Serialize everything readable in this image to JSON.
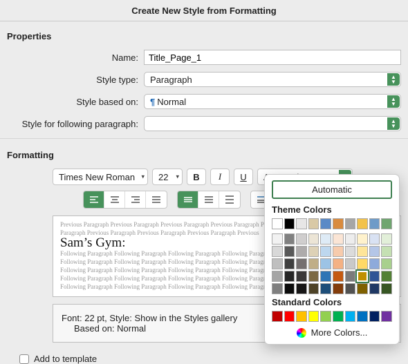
{
  "title": "Create New Style from Formatting",
  "sections": {
    "properties": "Properties",
    "formatting": "Formatting"
  },
  "props": {
    "name_label": "Name:",
    "name_value": "Title_Page_1",
    "type_label": "Style type:",
    "type_value": "Paragraph",
    "based_label": "Style based on:",
    "based_value": "Normal",
    "following_label": "Style for following paragraph:",
    "following_value": ""
  },
  "toolbar": {
    "font": "Times New Roman",
    "size": "22",
    "bold": "B",
    "italic": "I",
    "underline": "U",
    "color_label": "Automatic"
  },
  "preview": {
    "prev_line1": "Previous Paragraph Previous Paragraph Previous Paragraph Previous Paragraph Previous Paragraph Previous",
    "prev_line2": "Paragraph Previous Paragraph Previous Paragraph Previous Paragraph Previous",
    "sample": "Sam’s Gym:",
    "follow_line": "Following Paragraph Following Paragraph Following Paragraph Following Paragraph Following Paragraph"
  },
  "summary": {
    "line1": "Font: 22 pt, Style: Show in the Styles gallery",
    "line2": "Based on: Normal"
  },
  "footer": {
    "add_to_template": "Add to template"
  },
  "popover": {
    "automatic": "Automatic",
    "theme_head": "Theme Colors",
    "standard_head": "Standard Colors",
    "more": "More Colors...",
    "theme_row1": [
      "#ffffff",
      "#000000",
      "#e7e6e6",
      "#d9c9a6",
      "#5a8ac6",
      "#d98b3e",
      "#a6a6a6",
      "#f2c24b",
      "#6e9bc8",
      "#6fa56f"
    ],
    "theme_shades": [
      [
        "#f2f2f2",
        "#808080",
        "#d0cece",
        "#ece5d6",
        "#deebf6",
        "#fbe5d5",
        "#ededed",
        "#fff2cc",
        "#d9e2f3",
        "#e2efd9"
      ],
      [
        "#d8d8d8",
        "#595959",
        "#aeabab",
        "#ddd1b6",
        "#bdd7ee",
        "#f7cbac",
        "#dbdbdb",
        "#fee599",
        "#b4c6e7",
        "#c5e0b3"
      ],
      [
        "#bfbfbf",
        "#3f3f3f",
        "#757070",
        "#c0ae87",
        "#9cc3e5",
        "#f4b183",
        "#c9c9c9",
        "#ffd965",
        "#8eaadb",
        "#a8d08d"
      ],
      [
        "#a5a5a5",
        "#262626",
        "#3a3838",
        "#7c6a44",
        "#2e75b5",
        "#c55a11",
        "#7b7b7b",
        "#bf9000",
        "#2f5496",
        "#538135"
      ],
      [
        "#7f7f7f",
        "#0c0c0c",
        "#171616",
        "#4e4327",
        "#1e4e79",
        "#833c0b",
        "#525252",
        "#7f6000",
        "#1f3864",
        "#375623"
      ]
    ],
    "selected_theme": [
      3,
      7
    ],
    "standard": [
      "#c00000",
      "#ff0000",
      "#ffc000",
      "#ffff00",
      "#92d050",
      "#00b050",
      "#00b0f0",
      "#0070c0",
      "#002060",
      "#7030a0"
    ]
  }
}
